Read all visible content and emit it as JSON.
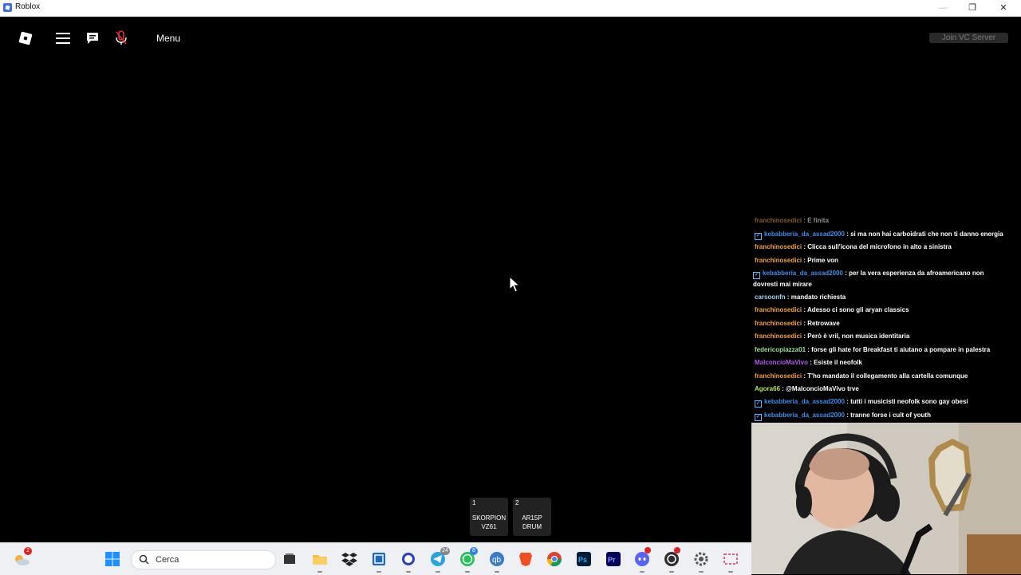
{
  "window": {
    "title": "Roblox",
    "minimize": "—",
    "maximize": "❐",
    "close": "✕"
  },
  "topbar": {
    "menu_label": "Menu",
    "vc_button": "Join VC Server"
  },
  "chat": [
    {
      "name": "franchinosedici",
      "text": " : È finita",
      "color": "#f2a33a",
      "badge": false,
      "faded": true
    },
    {
      "name": "kebabberia_da_assad2000",
      "text": " : si ma non hai carboidrati che non ti danno energia",
      "color": "#3f8eea",
      "badge": true
    },
    {
      "name": "franchinosedici",
      "text": " : Clicca sull'icona del microfono in alto a sinistra",
      "color": "#f2a33a",
      "badge": false
    },
    {
      "name": "franchinosedici",
      "text": " : Prime von",
      "color": "#f2a33a",
      "badge": false
    },
    {
      "name": "kebabberia_da_assad2000",
      "text": " : per la vera esperienza da afroamericano non dovresti mai mirare",
      "color": "#3f8eea",
      "badge": true
    },
    {
      "name": "carsoonfn",
      "text": " : mandato richiesta",
      "color": "#9fd2f5",
      "badge": false
    },
    {
      "name": "franchinosedici",
      "text": " : Adesso ci sono gli aryan classics",
      "color": "#f2a33a",
      "badge": false
    },
    {
      "name": "franchinosedici",
      "text": " : Retrowave",
      "color": "#f2a33a",
      "badge": false
    },
    {
      "name": "franchinosedici",
      "text": " : Però è vril, non musica identitaria",
      "color": "#f2a33a",
      "badge": false
    },
    {
      "name": "federicopiazza01",
      "text": " : forse gli hate for Breakfast ti aiutano a pompare in palestra",
      "color": "#9fe09a",
      "badge": false
    },
    {
      "name": "MalconcioMaVivo",
      "text": " : Esiste il neofolk",
      "color": "#b45be8",
      "badge": false
    },
    {
      "name": "franchinosedici",
      "text": " : T'ho mandato il collegamento alla cartella comunque",
      "color": "#f2a33a",
      "badge": false
    },
    {
      "name": "Agora66",
      "text": " : @MalconcioMaVivo trve",
      "color": "#b0e85c",
      "badge": false
    },
    {
      "name": "kebabberia_da_assad2000",
      "text": " : tutti i musicisti neofolk sono gay obesi",
      "color": "#3f8eea",
      "badge": true
    },
    {
      "name": "kebabberia_da_assad2000",
      "text": " : tranne forse i cult of youth",
      "color": "#3f8eea",
      "badge": true
    }
  ],
  "hotbar": [
    {
      "num": "1",
      "line1": "SKORPION",
      "line2": "VZ61"
    },
    {
      "num": "2",
      "line1": "AR15P",
      "line2": "DRUM"
    }
  ],
  "taskbar": {
    "search_label": "Cerca",
    "weather_badge": "2",
    "telegram_badge": "24",
    "whatsapp_badge": "8"
  },
  "colors": {
    "accent": "#3d6fd8",
    "background": "#000000",
    "taskbar": "#eef0f4"
  }
}
